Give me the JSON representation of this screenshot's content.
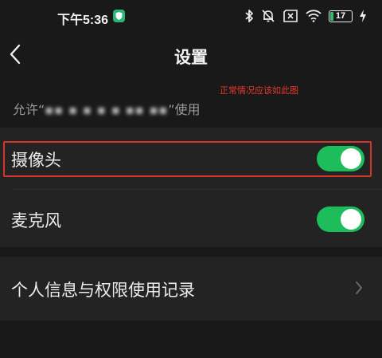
{
  "status_bar": {
    "time": "下午5:36",
    "battery_level": "17",
    "battery_percent": 17
  },
  "nav": {
    "title": "设置"
  },
  "annotation": "正常情况应该如此图",
  "permission_description": {
    "prefix": "允许“",
    "suffix": "”使用"
  },
  "settings": [
    {
      "label": "摄像头",
      "enabled": true
    },
    {
      "label": "麦克风",
      "enabled": true
    }
  ],
  "records_item": {
    "label": "个人信息与权限使用记录"
  },
  "colors": {
    "toggle_on": "#1ebd5c",
    "highlight": "#d4362a",
    "annotation": "#e8372c"
  }
}
